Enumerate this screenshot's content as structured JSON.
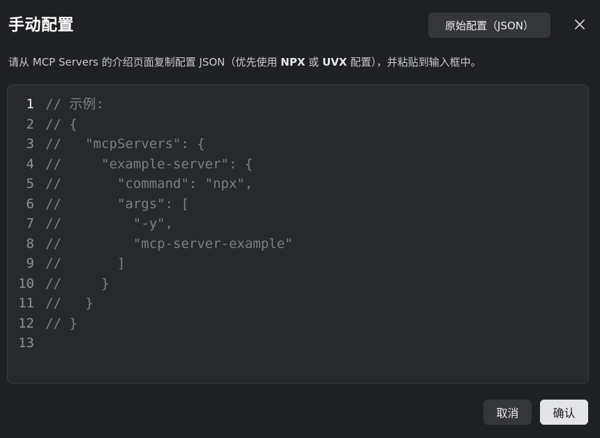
{
  "dialog": {
    "title": "手动配置",
    "raw_config_button": "原始配置（JSON）",
    "description": {
      "prefix": "请从 MCP Servers 的介绍页面复制配置 JSON（优先使用 ",
      "npx": "NPX",
      "or": " 或 ",
      "uvx": "UVX",
      "suffix": " 配置），并粘贴到输入框中。"
    }
  },
  "editor": {
    "active_line": 1,
    "lines": [
      {
        "number": "1",
        "text": "// 示例:"
      },
      {
        "number": "2",
        "text": "// {"
      },
      {
        "number": "3",
        "text": "//   \"mcpServers\": {"
      },
      {
        "number": "4",
        "text": "//     \"example-server\": {"
      },
      {
        "number": "5",
        "text": "//       \"command\": \"npx\","
      },
      {
        "number": "6",
        "text": "//       \"args\": ["
      },
      {
        "number": "7",
        "text": "//         \"-y\","
      },
      {
        "number": "8",
        "text": "//         \"mcp-server-example\""
      },
      {
        "number": "9",
        "text": "//       ]"
      },
      {
        "number": "10",
        "text": "//     }"
      },
      {
        "number": "11",
        "text": "//   }"
      },
      {
        "number": "12",
        "text": "// }"
      },
      {
        "number": "13",
        "text": ""
      }
    ]
  },
  "footer": {
    "cancel_label": "取消",
    "confirm_label": "确认"
  },
  "colors": {
    "background": "#1f2023",
    "editor_background": "#27292c",
    "comment": "#7c7f85",
    "confirm_button": "#e3e4e8"
  }
}
